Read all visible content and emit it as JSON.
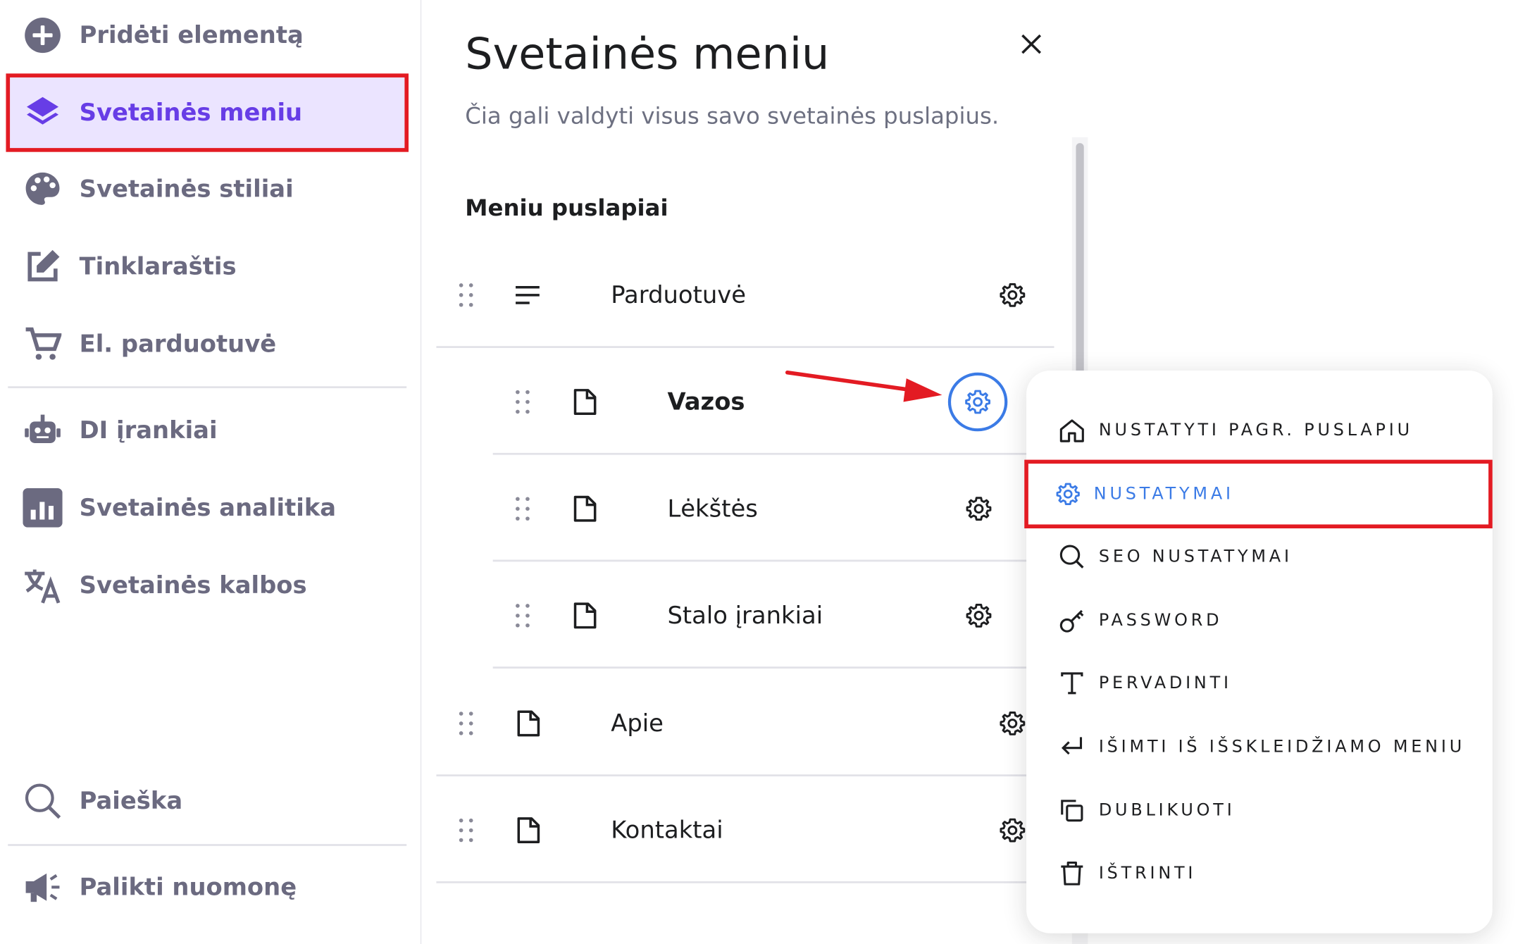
{
  "sidebar": {
    "items": [
      {
        "label": "Pridėti elementą",
        "icon": "plus-circle-icon"
      },
      {
        "label": "Svetainės meniu",
        "icon": "layers-icon",
        "active": true
      },
      {
        "label": "Svetainės stiliai",
        "icon": "palette-icon"
      },
      {
        "label": "Tinklaraštis",
        "icon": "edit-icon"
      },
      {
        "label": "El. parduotuvė",
        "icon": "cart-icon"
      },
      {
        "label": "DI įrankiai",
        "icon": "robot-icon"
      },
      {
        "label": "Svetainės analitika",
        "icon": "analytics-icon"
      },
      {
        "label": "Svetainės kalbos",
        "icon": "translate-icon"
      },
      {
        "label": "Paieška",
        "icon": "search-icon"
      },
      {
        "label": "Palikti nuomonę",
        "icon": "megaphone-icon"
      }
    ]
  },
  "panel": {
    "title": "Svetainės meniu",
    "subtitle": "Čia gali valdyti visus savo svetainės puslapius.",
    "section": "Meniu puslapiai",
    "pages": [
      {
        "label": "Parduotuvė",
        "icon": "dropdown-list-icon",
        "level": 0
      },
      {
        "label": "Vazos",
        "icon": "page-icon",
        "level": 1,
        "active": true
      },
      {
        "label": "Lėkštės",
        "icon": "page-icon",
        "level": 1
      },
      {
        "label": "Stalo įrankiai",
        "icon": "page-icon",
        "level": 1
      },
      {
        "label": "Apie",
        "icon": "page-icon",
        "level": 0
      },
      {
        "label": "Kontaktai",
        "icon": "page-icon",
        "level": 0
      }
    ]
  },
  "menu": {
    "items": [
      {
        "label": "NUSTATYTI PAGR. PUSLAPIU",
        "icon": "home-icon"
      },
      {
        "label": "NUSTATYMAI",
        "icon": "gear-icon",
        "highlighted": true
      },
      {
        "label": "SEO NUSTATYMAI",
        "icon": "search-icon"
      },
      {
        "label": "PASSWORD",
        "icon": "key-icon"
      },
      {
        "label": "PERVADINTI",
        "icon": "text-icon"
      },
      {
        "label": "IŠIMTI IŠ IŠSKLEIDŽIAMO MENIU",
        "icon": "return-icon"
      },
      {
        "label": "DUBLIKUOTI",
        "icon": "duplicate-icon"
      },
      {
        "label": "IŠTRINTI",
        "icon": "trash-icon"
      }
    ]
  },
  "colors": {
    "accent": "#673de6",
    "active_bg": "#ebe4ff",
    "highlight_red": "#e31b23",
    "link_blue": "#3b7be6",
    "text_muted": "#6b6a80"
  }
}
